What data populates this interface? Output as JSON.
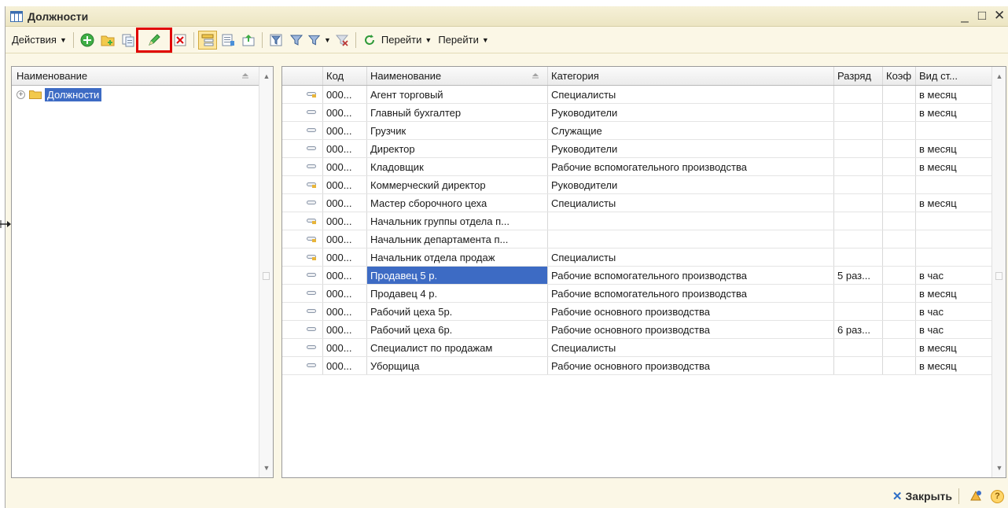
{
  "window": {
    "title": "Должности",
    "controls": [
      "_",
      "□",
      "✕"
    ]
  },
  "toolbar": {
    "actions_label": "Действия",
    "goto_label_1": "Перейти",
    "goto_label_2": "Перейти",
    "highlight_color": "#e00000"
  },
  "left_panel": {
    "header": "Наименование",
    "tree": [
      {
        "label": "Должности",
        "selected": true
      }
    ]
  },
  "grid": {
    "columns": [
      "",
      "Код",
      "Наименование",
      "Категория",
      "Разряд",
      "Коэф",
      "Вид ст..."
    ],
    "rows": [
      {
        "icon": "group",
        "code": "000...",
        "name": "Агент торговый",
        "category": "Специалисты",
        "rank": "",
        "coef": "",
        "kind": "в месяц"
      },
      {
        "icon": "item",
        "code": "000...",
        "name": "Главный бухгалтер",
        "category": "Руководители",
        "rank": "",
        "coef": "",
        "kind": "в месяц"
      },
      {
        "icon": "item",
        "code": "000...",
        "name": "Грузчик",
        "category": "Служащие",
        "rank": "",
        "coef": "",
        "kind": ""
      },
      {
        "icon": "item",
        "code": "000...",
        "name": "Директор",
        "category": "Руководители",
        "rank": "",
        "coef": "",
        "kind": "в месяц"
      },
      {
        "icon": "item",
        "code": "000...",
        "name": "Кладовщик",
        "category": "Рабочие вспомогательного производства",
        "rank": "",
        "coef": "",
        "kind": "в месяц"
      },
      {
        "icon": "group",
        "code": "000...",
        "name": "Коммерческий директор",
        "category": "Руководители",
        "rank": "",
        "coef": "",
        "kind": ""
      },
      {
        "icon": "item",
        "code": "000...",
        "name": "Мастер сборочного цеха",
        "category": "Специалисты",
        "rank": "",
        "coef": "",
        "kind": "в месяц"
      },
      {
        "icon": "group",
        "code": "000...",
        "name": "Начальник группы отдела п...",
        "category": "",
        "rank": "",
        "coef": "",
        "kind": ""
      },
      {
        "icon": "group",
        "code": "000...",
        "name": "Начальник департамента п...",
        "category": "",
        "rank": "",
        "coef": "",
        "kind": ""
      },
      {
        "icon": "group",
        "code": "000...",
        "name": "Начальник отдела продаж",
        "category": "Специалисты",
        "rank": "",
        "coef": "",
        "kind": ""
      },
      {
        "icon": "item",
        "code": "000...",
        "name": "Продавец 5 р.",
        "category": "Рабочие вспомогательного производства",
        "rank": "5 раз...",
        "coef": "",
        "kind": "в час",
        "selected": true
      },
      {
        "icon": "item",
        "code": "000...",
        "name": "Продавец 4 р.",
        "category": "Рабочие вспомогательного производства",
        "rank": "",
        "coef": "",
        "kind": "в месяц"
      },
      {
        "icon": "item",
        "code": "000...",
        "name": "Рабочий цеха 5р.",
        "category": "Рабочие основного производства",
        "rank": "",
        "coef": "",
        "kind": "в час"
      },
      {
        "icon": "item",
        "code": "000...",
        "name": "Рабочий цеха 6р.",
        "category": "Рабочие основного производства",
        "rank": "6 раз...",
        "coef": "",
        "kind": "в час"
      },
      {
        "icon": "item",
        "code": "000...",
        "name": "Специалист по продажам",
        "category": "Специалисты",
        "rank": "",
        "coef": "",
        "kind": "в месяц"
      },
      {
        "icon": "item",
        "code": "000...",
        "name": "Уборщица",
        "category": "Рабочие основного производства",
        "rank": "",
        "coef": "",
        "kind": "в месяц"
      }
    ]
  },
  "status": {
    "close_label": "Закрыть",
    "help_label": "?"
  }
}
